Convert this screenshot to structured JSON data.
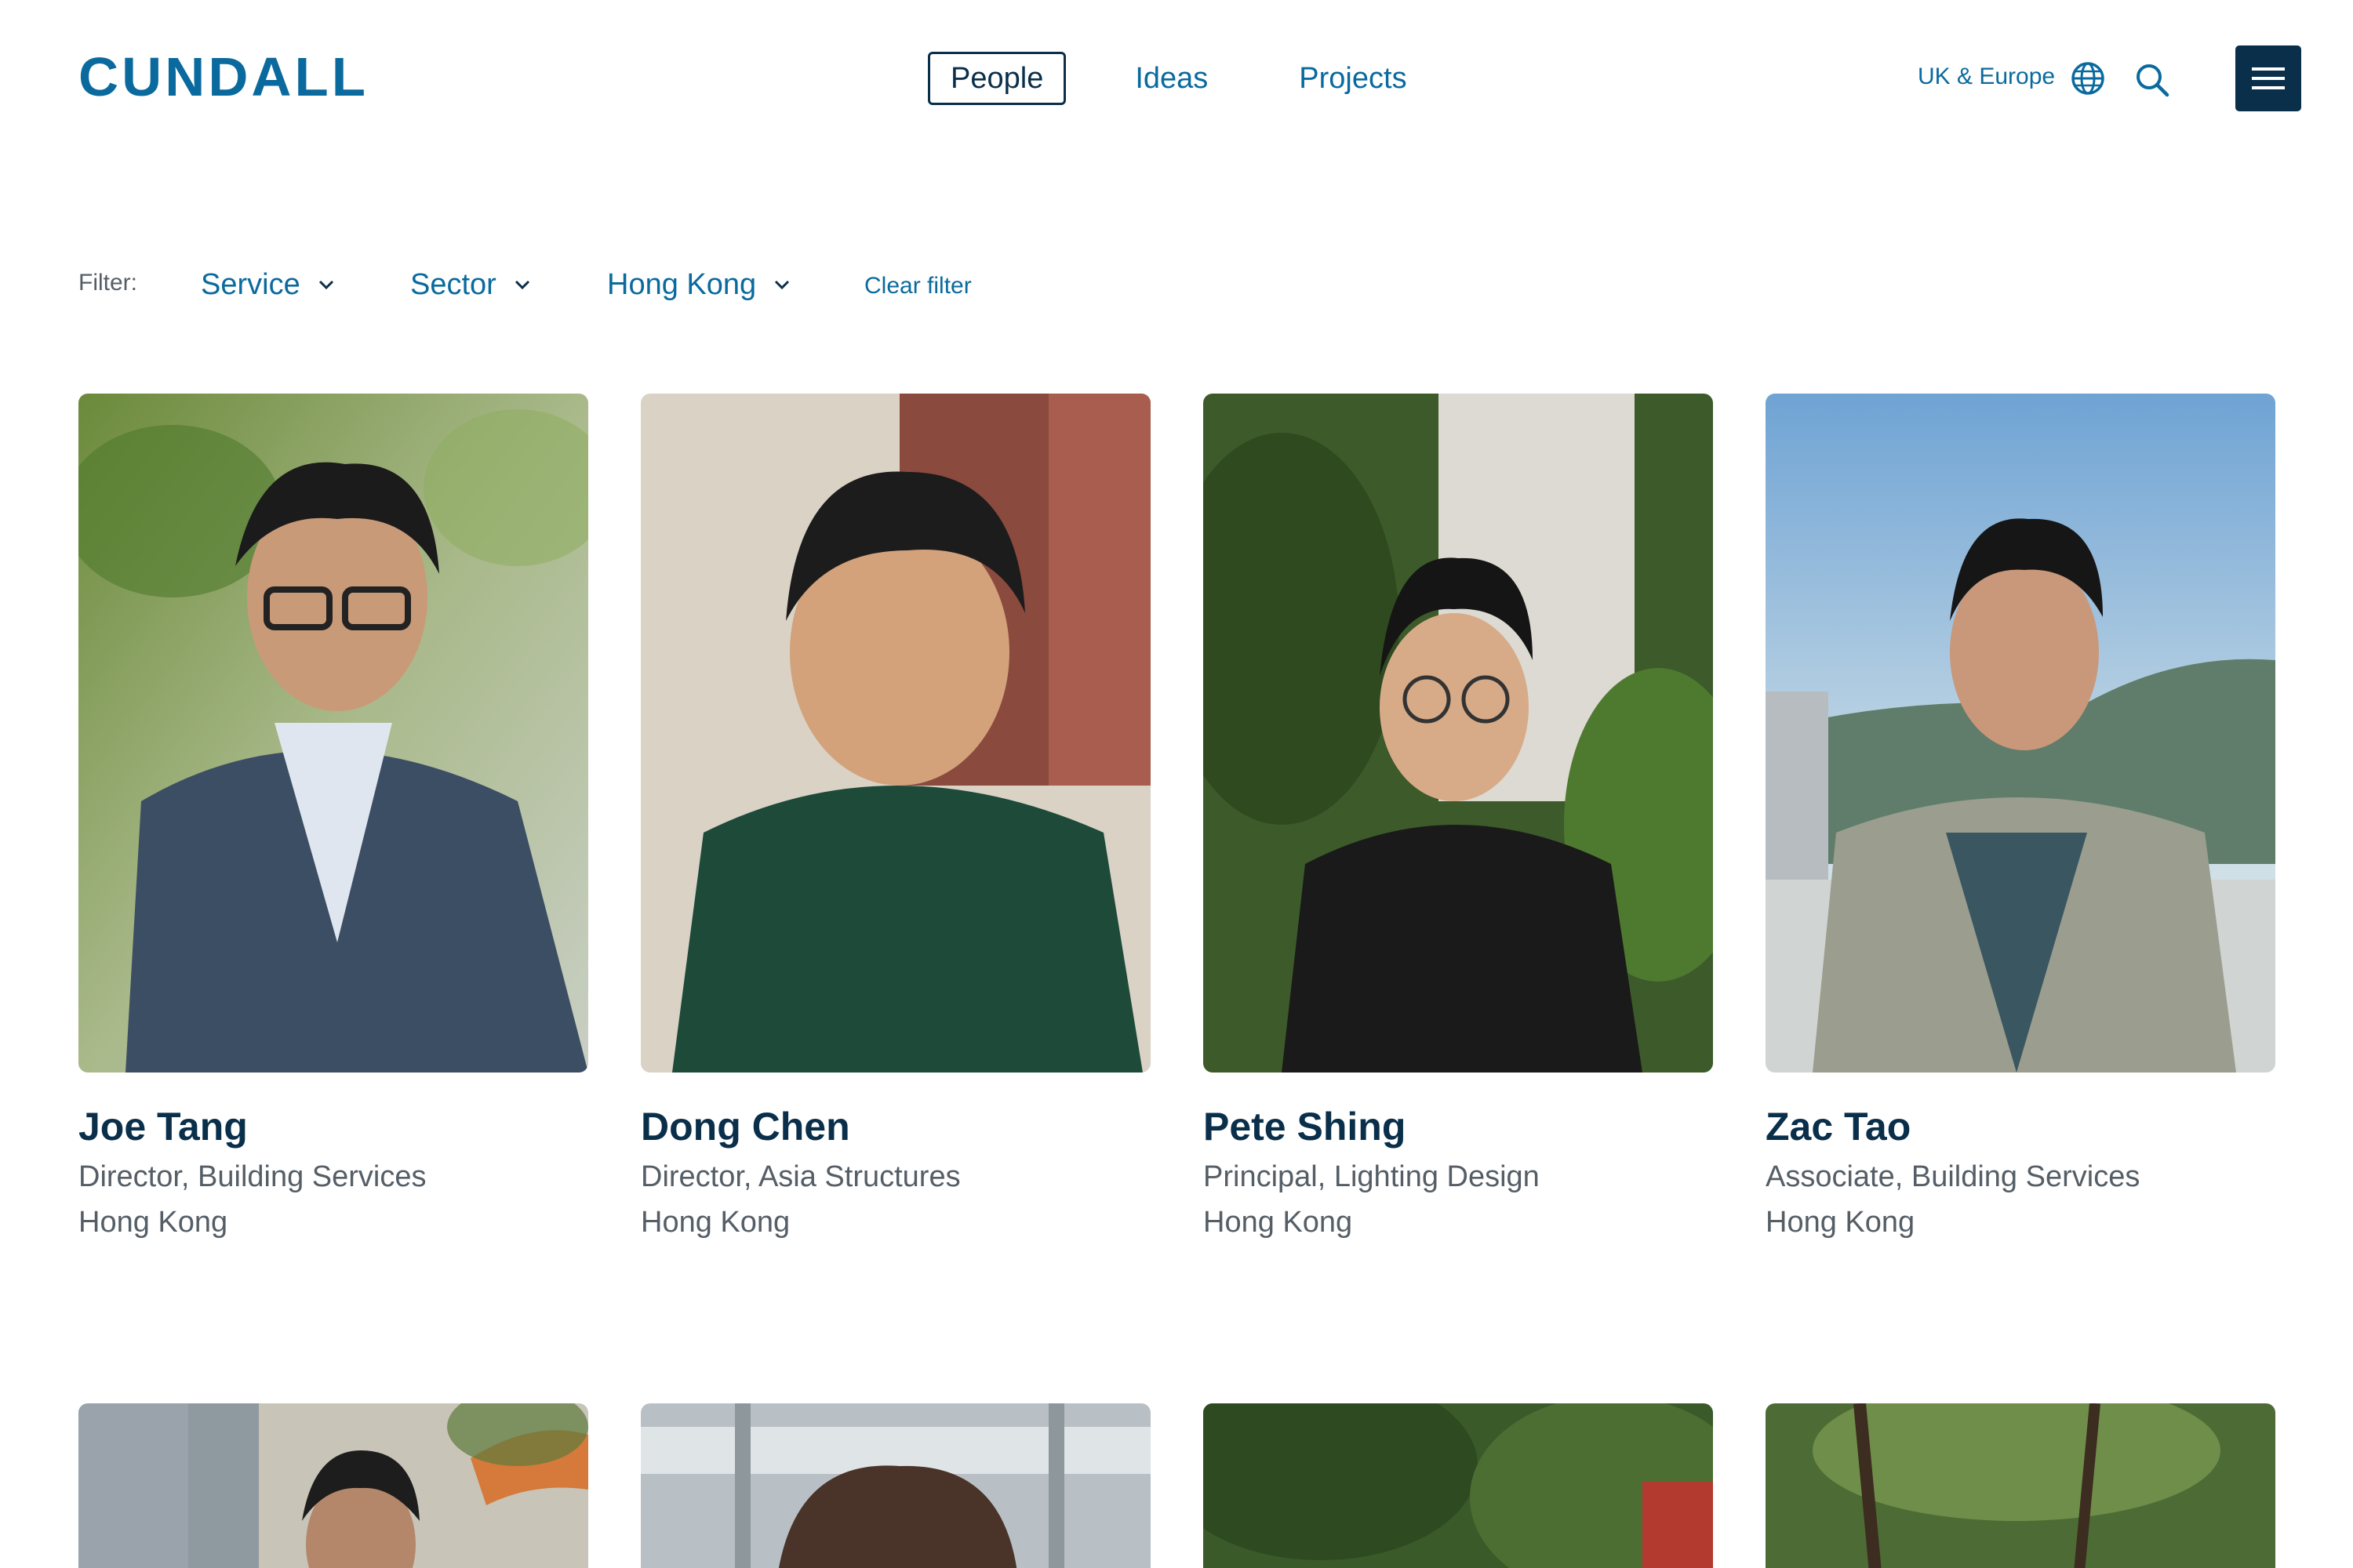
{
  "header": {
    "logo_text": "CUNDALL",
    "nav": [
      {
        "label": "People",
        "active": true
      },
      {
        "label": "Ideas",
        "active": false
      },
      {
        "label": "Projects",
        "active": false
      }
    ],
    "region_label": "UK & Europe",
    "icons": [
      "globe-icon",
      "search-icon",
      "hamburger-menu-icon"
    ]
  },
  "filter": {
    "label": "Filter:",
    "service": "Service",
    "sector": "Sector",
    "location": "Hong Kong",
    "clear": "Clear filter"
  },
  "people": [
    {
      "name": "Joe Tang",
      "role": "Director, Building Services",
      "location": "Hong Kong"
    },
    {
      "name": "Dong Chen",
      "role": "Director, Asia Structures",
      "location": "Hong Kong"
    },
    {
      "name": "Pete Shing",
      "role": "Principal, Lighting Design",
      "location": "Hong Kong"
    },
    {
      "name": "Zac Tao",
      "role": "Associate, Building Services",
      "location": "Hong Kong"
    }
  ],
  "colors": {
    "brand_dark": "#0a2f4a",
    "brand_link": "#0a6a9e",
    "muted_text": "#555e66"
  }
}
